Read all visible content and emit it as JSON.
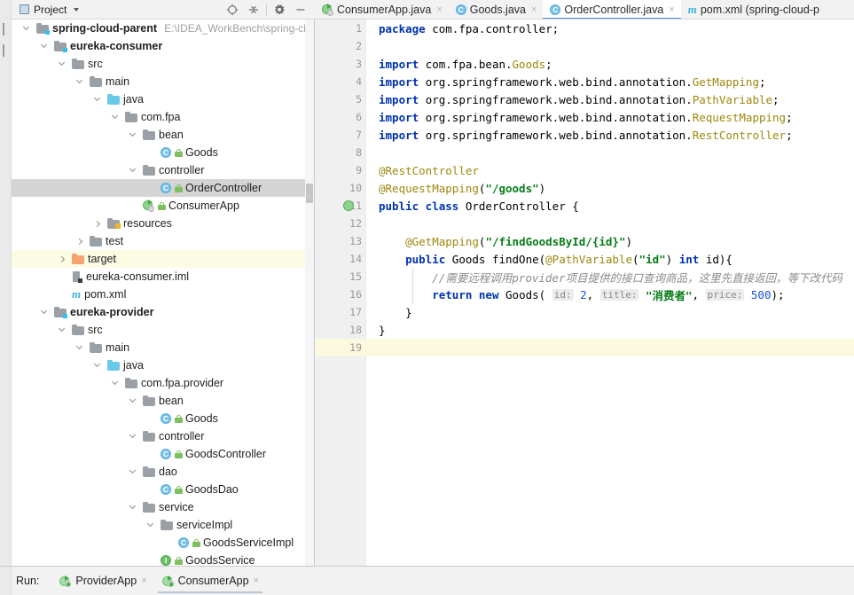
{
  "project_panel": {
    "title": "Project",
    "title_icon": "project-window-icon",
    "dropdown_icon": "chevron-down-icon",
    "tools": [
      {
        "name": "locate-target-icon",
        "label": ""
      },
      {
        "name": "collapse-all-icon",
        "label": ""
      },
      {
        "name": "settings-gear-icon",
        "label": ""
      },
      {
        "name": "hide-panel-icon",
        "label": ""
      }
    ],
    "tree": [
      {
        "indent": 0,
        "twist": "open",
        "icon": "module-folder",
        "label": "spring-cloud-parent",
        "bold": true,
        "path": "E:\\IDEA_WorkBench\\spring-clo",
        "state": ""
      },
      {
        "indent": 1,
        "twist": "open",
        "icon": "module-folder",
        "label": "eureka-consumer",
        "bold": true,
        "path": "",
        "state": ""
      },
      {
        "indent": 2,
        "twist": "open",
        "icon": "gray-folder",
        "label": "src",
        "bold": false,
        "path": "",
        "state": ""
      },
      {
        "indent": 3,
        "twist": "open",
        "icon": "gray-folder",
        "label": "main",
        "bold": false,
        "path": "",
        "state": ""
      },
      {
        "indent": 4,
        "twist": "open",
        "icon": "source-folder",
        "label": "java",
        "bold": false,
        "path": "",
        "state": ""
      },
      {
        "indent": 5,
        "twist": "open",
        "icon": "package",
        "label": "com.fpa",
        "bold": false,
        "path": "",
        "state": ""
      },
      {
        "indent": 6,
        "twist": "open",
        "icon": "package",
        "label": "bean",
        "bold": false,
        "path": "",
        "state": ""
      },
      {
        "indent": 7,
        "twist": "none",
        "icon": "java-class",
        "label": "Goods",
        "bold": false,
        "path": "",
        "state": ""
      },
      {
        "indent": 6,
        "twist": "open",
        "icon": "package",
        "label": "controller",
        "bold": false,
        "path": "",
        "state": ""
      },
      {
        "indent": 7,
        "twist": "none",
        "icon": "java-class",
        "label": "OrderController",
        "bold": false,
        "path": "",
        "state": "selected"
      },
      {
        "indent": 6,
        "twist": "none",
        "icon": "spring-app",
        "label": "ConsumerApp",
        "bold": false,
        "path": "",
        "state": ""
      },
      {
        "indent": 4,
        "twist": "closed",
        "icon": "resource-folder",
        "label": "resources",
        "bold": false,
        "path": "",
        "state": ""
      },
      {
        "indent": 3,
        "twist": "closed",
        "icon": "gray-folder",
        "label": "test",
        "bold": false,
        "path": "",
        "state": ""
      },
      {
        "indent": 2,
        "twist": "closed",
        "icon": "orange-folder",
        "label": "target",
        "bold": false,
        "path": "",
        "state": "highlight"
      },
      {
        "indent": 2,
        "twist": "none",
        "icon": "iml-file",
        "label": "eureka-consumer.iml",
        "bold": false,
        "path": "",
        "state": ""
      },
      {
        "indent": 2,
        "twist": "none",
        "icon": "maven-file",
        "label": "pom.xml",
        "bold": false,
        "path": "",
        "state": ""
      },
      {
        "indent": 1,
        "twist": "open",
        "icon": "module-folder",
        "label": "eureka-provider",
        "bold": true,
        "path": "",
        "state": ""
      },
      {
        "indent": 2,
        "twist": "open",
        "icon": "gray-folder",
        "label": "src",
        "bold": false,
        "path": "",
        "state": ""
      },
      {
        "indent": 3,
        "twist": "open",
        "icon": "gray-folder",
        "label": "main",
        "bold": false,
        "path": "",
        "state": ""
      },
      {
        "indent": 4,
        "twist": "open",
        "icon": "source-folder",
        "label": "java",
        "bold": false,
        "path": "",
        "state": ""
      },
      {
        "indent": 5,
        "twist": "open",
        "icon": "package",
        "label": "com.fpa.provider",
        "bold": false,
        "path": "",
        "state": ""
      },
      {
        "indent": 6,
        "twist": "open",
        "icon": "package",
        "label": "bean",
        "bold": false,
        "path": "",
        "state": ""
      },
      {
        "indent": 7,
        "twist": "none",
        "icon": "java-class",
        "label": "Goods",
        "bold": false,
        "path": "",
        "state": ""
      },
      {
        "indent": 6,
        "twist": "open",
        "icon": "package",
        "label": "controller",
        "bold": false,
        "path": "",
        "state": ""
      },
      {
        "indent": 7,
        "twist": "none",
        "icon": "java-class",
        "label": "GoodsController",
        "bold": false,
        "path": "",
        "state": ""
      },
      {
        "indent": 6,
        "twist": "open",
        "icon": "package",
        "label": "dao",
        "bold": false,
        "path": "",
        "state": ""
      },
      {
        "indent": 7,
        "twist": "none",
        "icon": "java-class",
        "label": "GoodsDao",
        "bold": false,
        "path": "",
        "state": ""
      },
      {
        "indent": 6,
        "twist": "open",
        "icon": "package",
        "label": "service",
        "bold": false,
        "path": "",
        "state": ""
      },
      {
        "indent": 7,
        "twist": "open",
        "icon": "package",
        "label": "serviceImpl",
        "bold": false,
        "path": "",
        "state": ""
      },
      {
        "indent": 8,
        "twist": "none",
        "icon": "java-class",
        "label": "GoodsServiceImpl",
        "bold": false,
        "path": "",
        "state": ""
      },
      {
        "indent": 7,
        "twist": "none",
        "icon": "java-interface",
        "label": "GoodsService",
        "bold": false,
        "path": "",
        "state": ""
      }
    ]
  },
  "editor_tabs": [
    {
      "icon": "spring-app",
      "label": "ConsumerApp.java",
      "active": false,
      "close": "×"
    },
    {
      "icon": "java-class",
      "label": "Goods.java",
      "active": false,
      "close": "×"
    },
    {
      "icon": "java-class",
      "label": "OrderController.java",
      "active": true,
      "close": "×"
    },
    {
      "icon": "maven-file",
      "label": "pom.xml (spring-cloud-p",
      "active": false,
      "close": ""
    }
  ],
  "editor": {
    "active_file": "OrderController.java",
    "caret_line": 19,
    "line_count": 19,
    "lines": [
      {
        "n": 1,
        "fold": "",
        "run_icon": false,
        "tokens": [
          {
            "t": "package ",
            "c": "kw"
          },
          {
            "t": "com.fpa.controller;",
            "c": "plain"
          }
        ]
      },
      {
        "n": 2,
        "fold": "",
        "run_icon": false,
        "tokens": []
      },
      {
        "n": 3,
        "fold": "open",
        "run_icon": false,
        "tokens": [
          {
            "t": "import ",
            "c": "kw"
          },
          {
            "t": "com.fpa.bean.",
            "c": "plain"
          },
          {
            "t": "Goods",
            "c": "ann"
          },
          {
            "t": ";",
            "c": "plain"
          }
        ]
      },
      {
        "n": 4,
        "fold": "",
        "run_icon": false,
        "tokens": [
          {
            "t": "import ",
            "c": "kw"
          },
          {
            "t": "org.springframework.web.bind.annotation.",
            "c": "plain"
          },
          {
            "t": "GetMapping",
            "c": "ann"
          },
          {
            "t": ";",
            "c": "plain"
          }
        ]
      },
      {
        "n": 5,
        "fold": "",
        "run_icon": false,
        "tokens": [
          {
            "t": "import ",
            "c": "kw"
          },
          {
            "t": "org.springframework.web.bind.annotation.",
            "c": "plain"
          },
          {
            "t": "PathVariable",
            "c": "ann"
          },
          {
            "t": ";",
            "c": "plain"
          }
        ]
      },
      {
        "n": 6,
        "fold": "",
        "run_icon": false,
        "tokens": [
          {
            "t": "import ",
            "c": "kw"
          },
          {
            "t": "org.springframework.web.bind.annotation.",
            "c": "plain"
          },
          {
            "t": "RequestMapping",
            "c": "ann"
          },
          {
            "t": ";",
            "c": "plain"
          }
        ]
      },
      {
        "n": 7,
        "fold": "close",
        "run_icon": false,
        "tokens": [
          {
            "t": "import ",
            "c": "kw"
          },
          {
            "t": "org.springframework.web.bind.annotation.",
            "c": "plain"
          },
          {
            "t": "RestController",
            "c": "ann"
          },
          {
            "t": ";",
            "c": "plain"
          }
        ]
      },
      {
        "n": 8,
        "fold": "",
        "run_icon": false,
        "tokens": []
      },
      {
        "n": 9,
        "fold": "open",
        "run_icon": false,
        "tokens": [
          {
            "t": "@RestController",
            "c": "ann"
          }
        ]
      },
      {
        "n": 10,
        "fold": "close",
        "run_icon": false,
        "tokens": [
          {
            "t": "@RequestMapping",
            "c": "ann"
          },
          {
            "t": "(",
            "c": "plain"
          },
          {
            "t": "\"/goods\"",
            "c": "str"
          },
          {
            "t": ")",
            "c": "plain"
          }
        ]
      },
      {
        "n": 11,
        "fold": "",
        "run_icon": true,
        "tokens": [
          {
            "t": "public class ",
            "c": "kw"
          },
          {
            "t": "OrderController {",
            "c": "plain"
          }
        ]
      },
      {
        "n": 12,
        "fold": "",
        "run_icon": false,
        "tokens": []
      },
      {
        "n": 13,
        "fold": "",
        "run_icon": false,
        "tokens": [
          {
            "t": "    ",
            "c": "plain"
          },
          {
            "t": "@GetMapping",
            "c": "ann"
          },
          {
            "t": "(",
            "c": "plain"
          },
          {
            "t": "\"/findGoodsById/{id}\"",
            "c": "str"
          },
          {
            "t": ")",
            "c": "plain"
          }
        ]
      },
      {
        "n": 14,
        "fold": "open",
        "run_icon": false,
        "tokens": [
          {
            "t": "    ",
            "c": "plain"
          },
          {
            "t": "public ",
            "c": "kw"
          },
          {
            "t": "Goods findOne(",
            "c": "plain"
          },
          {
            "t": "@PathVariable",
            "c": "ann"
          },
          {
            "t": "(",
            "c": "plain"
          },
          {
            "t": "\"id\"",
            "c": "str"
          },
          {
            "t": ") ",
            "c": "plain"
          },
          {
            "t": "int ",
            "c": "kw"
          },
          {
            "t": "id){",
            "c": "plain"
          }
        ]
      },
      {
        "n": 15,
        "fold": "",
        "run_icon": false,
        "tokens": [
          {
            "t": "        ",
            "c": "plain"
          },
          {
            "t": "//需要远程调用provider项目提供的接口查询商品，这里先直接返回，等下改代码",
            "c": "cmt"
          }
        ]
      },
      {
        "n": 16,
        "fold": "",
        "run_icon": false,
        "tokens": [
          {
            "t": "        ",
            "c": "plain"
          },
          {
            "t": "return new ",
            "c": "kw"
          },
          {
            "t": "Goods( ",
            "c": "plain"
          },
          {
            "t": "id:",
            "c": "hint"
          },
          {
            "t": " ",
            "c": "plain"
          },
          {
            "t": "2",
            "c": "num"
          },
          {
            "t": ", ",
            "c": "plain"
          },
          {
            "t": "title:",
            "c": "hint"
          },
          {
            "t": " ",
            "c": "plain"
          },
          {
            "t": "\"消费者\"",
            "c": "str"
          },
          {
            "t": ", ",
            "c": "plain"
          },
          {
            "t": "price:",
            "c": "hint"
          },
          {
            "t": " ",
            "c": "plain"
          },
          {
            "t": "500",
            "c": "num"
          },
          {
            "t": ");",
            "c": "plain"
          }
        ]
      },
      {
        "n": 17,
        "fold": "close",
        "run_icon": false,
        "tokens": [
          {
            "t": "    }",
            "c": "plain"
          }
        ]
      },
      {
        "n": 18,
        "fold": "",
        "run_icon": false,
        "tokens": [
          {
            "t": "}",
            "c": "plain"
          }
        ]
      },
      {
        "n": 19,
        "fold": "",
        "run_icon": false,
        "tokens": []
      }
    ]
  },
  "run_bar": {
    "label": "Run:",
    "tabs": [
      {
        "icon": "spring-run-app",
        "label": "ProviderApp",
        "active": false,
        "close": "×"
      },
      {
        "icon": "spring-run-app",
        "label": "ConsumerApp",
        "active": true,
        "close": "×"
      }
    ]
  },
  "colors": {
    "accent_tab_underline": "#4a90d9",
    "selection_gray": "#d4d4d4",
    "caret_line_yellow": "#fdf8e0",
    "keyword_blue": "#0033b3",
    "string_green": "#067d17",
    "annotation_olive": "#9e880d",
    "number_blue": "#1750eb",
    "comment_gray": "#8c8c8c",
    "target_folder_orange": "#f5a471"
  }
}
